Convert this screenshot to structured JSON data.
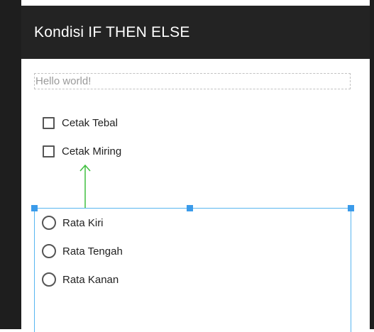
{
  "app": {
    "title": "Kondisi IF THEN ELSE"
  },
  "textview": {
    "text": "Hello world!"
  },
  "checkboxes": [
    {
      "label": "Cetak Tebal",
      "checked": false
    },
    {
      "label": "Cetak Miring",
      "checked": false
    }
  ],
  "radios": [
    {
      "label": "Rata Kiri",
      "selected": false
    },
    {
      "label": "Rata Tengah",
      "selected": false
    },
    {
      "label": "Rata Kanan",
      "selected": false
    }
  ],
  "colors": {
    "appbar": "#232323",
    "selection": "#58b6f0",
    "arrow": "#3fbf3f"
  }
}
